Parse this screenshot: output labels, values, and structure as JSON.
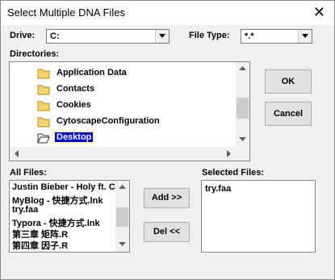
{
  "window": {
    "title": "Select Multiple DNA Files",
    "close_glyph": "✕"
  },
  "drive": {
    "label": "Drive:",
    "value": "C:"
  },
  "filetype": {
    "label": "File Type:",
    "value": "*.*"
  },
  "directories": {
    "label": "Directories:",
    "items": [
      {
        "name": "Application Data"
      },
      {
        "name": "Contacts"
      },
      {
        "name": "Cookies"
      },
      {
        "name": "CytoscapeConfiguration"
      },
      {
        "name": "Desktop",
        "selected": true
      }
    ]
  },
  "all_files": {
    "label": "All Files:",
    "items": [
      "Justin Bieber - Holy ft. C",
      "MyBlog - 快捷方式.lnk",
      "try.faa",
      "Typora - 快捷方式.lnk",
      "第三章 矩阵.R",
      "第四章 因子.R"
    ]
  },
  "selected_files": {
    "label": "Selected Files:",
    "items": [
      "try.faa"
    ]
  },
  "buttons": {
    "ok": "OK",
    "cancel": "Cancel",
    "add": "Add >>",
    "del": "Del <<"
  },
  "colors": {
    "selection": "#0000c8",
    "folder": "#f5d470",
    "background": "#f0f0f0"
  }
}
